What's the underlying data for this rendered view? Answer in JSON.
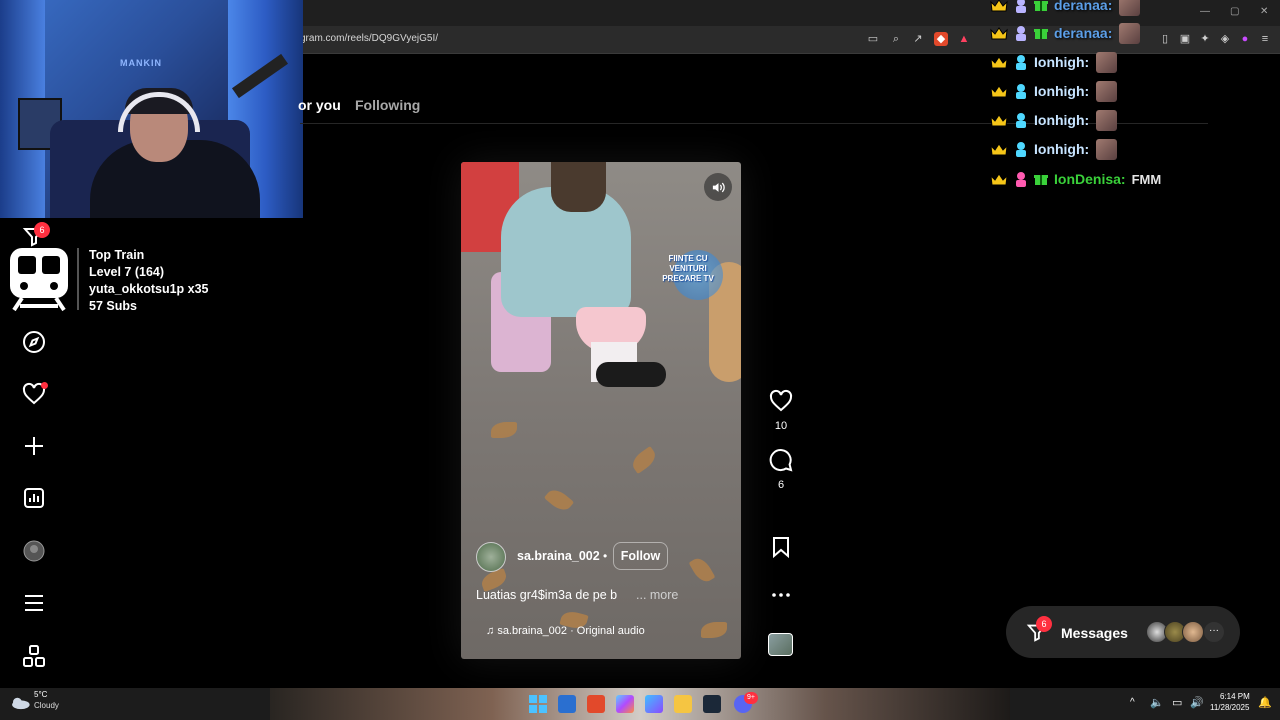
{
  "browser": {
    "url": "gram.com/reels/DQ9GVyejG5I/"
  },
  "tabs": {
    "for_you": "or you",
    "following": "Following"
  },
  "sidebar": {
    "filter_badge": "6"
  },
  "top_train": {
    "title": "Top Train",
    "level": "Level 7  (164)",
    "user": "yuta_okkotsu1p x35",
    "subs": "57 Subs"
  },
  "reel": {
    "username": "sa.braina_002",
    "separator": "•",
    "follow_label": "Follow",
    "caption": "Luatias gr4$im3a de pe b",
    "more_label": "... more",
    "audio": "sa.braina_002 · Original audio",
    "watermark": "FIINȚE CU VENITURI PRECARE TV"
  },
  "actions": {
    "likes": "10",
    "comments": "6"
  },
  "chat": [
    {
      "name": "deranaa:",
      "style": "blue",
      "msg": ""
    },
    {
      "name": "deranaa:",
      "style": "blue",
      "msg": ""
    },
    {
      "name": "Ionhigh:",
      "style": "light",
      "msg": ""
    },
    {
      "name": "Ionhigh:",
      "style": "light",
      "msg": ""
    },
    {
      "name": "Ionhigh:",
      "style": "light",
      "msg": ""
    },
    {
      "name": "Ionhigh:",
      "style": "light",
      "msg": ""
    },
    {
      "name": "IonDenisa:",
      "style": "green",
      "msg": "FMM"
    }
  ],
  "messages": {
    "label": "Messages",
    "badge": "6"
  },
  "taskbar": {
    "temperature": "5°C",
    "weather": "Cloudy",
    "time": "6:14 PM",
    "date": "11/28/2025",
    "discord_badge": "9+"
  },
  "webcam": {
    "sign": "MANKIN"
  },
  "colors": {
    "accent_red": "#ff3040",
    "crown": "#f5c518",
    "chat_green": "#3ad13a",
    "chat_blue": "#5c9fe8"
  }
}
